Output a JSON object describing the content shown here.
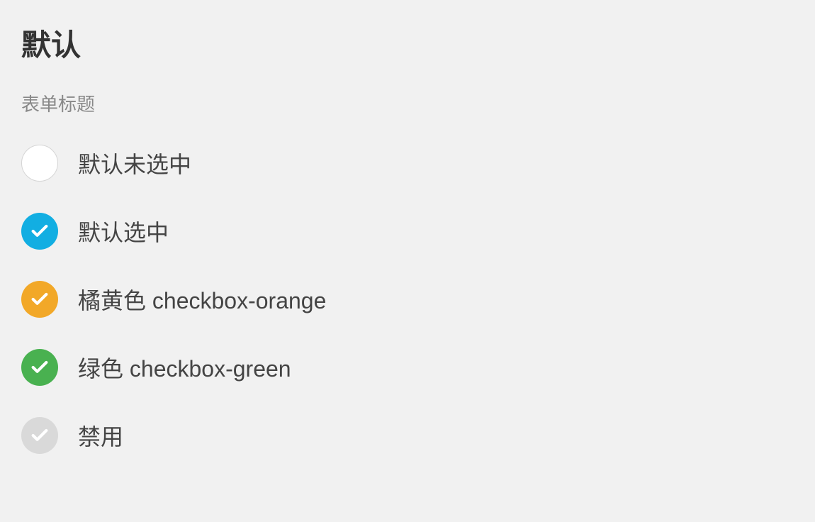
{
  "title": "默认",
  "subtitle": "表单标题",
  "checkboxes": [
    {
      "label": "默认未选中",
      "checked": false,
      "style": "unchecked",
      "interactable": true
    },
    {
      "label": "默认选中",
      "checked": true,
      "style": "blue",
      "interactable": true
    },
    {
      "label": "橘黄色 checkbox-orange",
      "checked": true,
      "style": "orange",
      "interactable": true
    },
    {
      "label": "绿色 checkbox-green",
      "checked": true,
      "style": "green",
      "interactable": true
    },
    {
      "label": "禁用",
      "checked": true,
      "style": "disabled",
      "interactable": false
    }
  ],
  "colors": {
    "blue": "#12aee2",
    "orange": "#f2a828",
    "green": "#49b150",
    "disabled": "#d9d9d9",
    "unchecked_bg": "#ffffff",
    "unchecked_border": "#d5d5d5"
  }
}
